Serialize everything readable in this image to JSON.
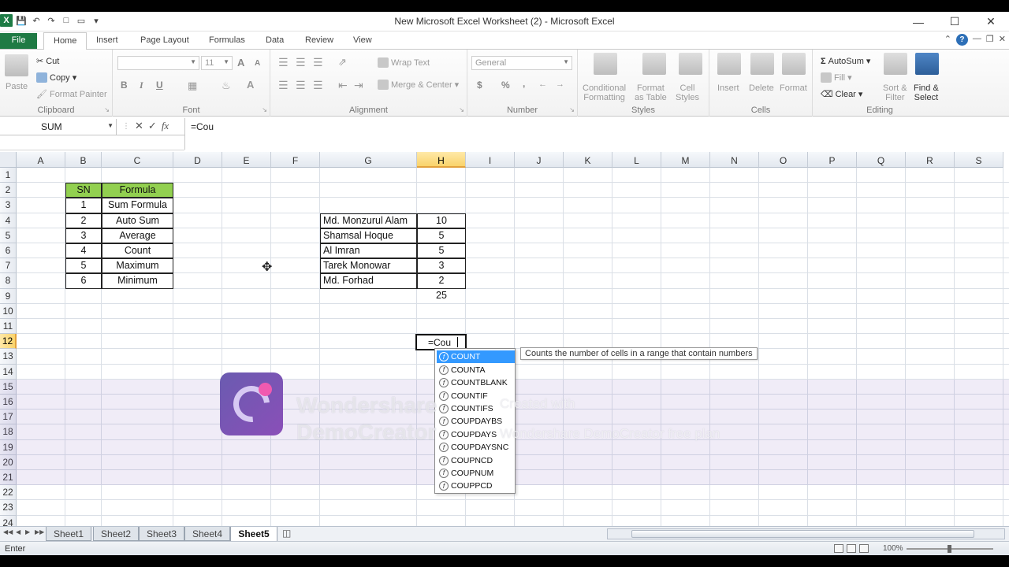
{
  "window": {
    "title": "New Microsoft Excel Worksheet (2)  -  Microsoft Excel",
    "app_icon_letter": "X"
  },
  "tabs": [
    "File",
    "Home",
    "Insert",
    "Page Layout",
    "Formulas",
    "Data",
    "Review",
    "View"
  ],
  "ribbon": {
    "clipboard": {
      "paste": "Paste",
      "cut": "Cut",
      "copy": "Copy",
      "format_painter": "Format Painter",
      "label": "Clipboard"
    },
    "font": {
      "size": "11",
      "grow": "A",
      "shrink": "A",
      "bold": "B",
      "italic": "I",
      "underline": "U",
      "label": "Font"
    },
    "alignment": {
      "wrap": "Wrap Text",
      "merge": "Merge & Center",
      "label": "Alignment"
    },
    "number": {
      "format": "General",
      "currency": "$",
      "percent": "%",
      "comma": ",",
      "label": "Number"
    },
    "styles": {
      "conditional_1": "Conditional",
      "conditional_2": "Formatting",
      "table_1": "Format",
      "table_2": "as Table",
      "cell_1": "Cell",
      "cell_2": "Styles",
      "label": "Styles"
    },
    "cells": {
      "insert": "Insert",
      "delete": "Delete",
      "format": "Format",
      "label": "Cells"
    },
    "editing": {
      "autosum": "AutoSum",
      "fill": "Fill",
      "clear": "Clear",
      "sort_1": "Sort &",
      "sort_2": "Filter",
      "find_1": "Find &",
      "find_2": "Select",
      "label": "Editing"
    }
  },
  "formula_bar": {
    "name_box": "SUM",
    "formula": "=Cou",
    "fx": "fx"
  },
  "columns": [
    "A",
    "B",
    "C",
    "D",
    "E",
    "F",
    "G",
    "H",
    "I",
    "J",
    "K",
    "L",
    "M",
    "N",
    "O",
    "P",
    "Q",
    "R",
    "S"
  ],
  "active_column": "H",
  "rows": [
    "1",
    "2",
    "3",
    "4",
    "5",
    "6",
    "7",
    "8",
    "9",
    "10",
    "11",
    "12",
    "13",
    "14",
    "15",
    "16",
    "17",
    "18",
    "19",
    "20",
    "21",
    "22",
    "23",
    "24"
  ],
  "active_row": "12",
  "table1": {
    "header": [
      "SN",
      "Formula"
    ],
    "rows": [
      [
        "1",
        "Sum Formula"
      ],
      [
        "2",
        "Auto Sum"
      ],
      [
        "3",
        "Average"
      ],
      [
        "4",
        "Count"
      ],
      [
        "5",
        "Maximum"
      ],
      [
        "6",
        "Minimum"
      ]
    ],
    "header_color": "#92d050"
  },
  "table2": {
    "rows": [
      [
        "Md. Monzurul Alam",
        "10"
      ],
      [
        "Shamsal Hoque",
        "5"
      ],
      [
        "Al Imran",
        "5"
      ],
      [
        "Tarek Monowar",
        "3"
      ],
      [
        "Md. Forhad",
        "2"
      ]
    ],
    "total": "25"
  },
  "editing_cell": {
    "value": "=Cou"
  },
  "autocomplete": {
    "items": [
      "COUNT",
      "COUNTA",
      "COUNTBLANK",
      "COUNTIF",
      "COUNTIFS",
      "COUPDAYBS",
      "COUPDAYS",
      "COUPDAYSNC",
      "COUPNCD",
      "COUPNUM",
      "COUPPCD"
    ],
    "selected_index": 0,
    "tooltip": "Counts the number of cells in a range that contain numbers"
  },
  "watermark": {
    "line1": "Wondershare",
    "line2": "DemoCreator",
    "small1": "Created with",
    "small2": "Wondershare DemoCreator free plan"
  },
  "sheets": [
    "Sheet1",
    "Sheet2",
    "Sheet3",
    "Sheet4",
    "Sheet5"
  ],
  "active_sheet": "Sheet5",
  "status": {
    "mode": "Enter",
    "zoom": "100%"
  }
}
